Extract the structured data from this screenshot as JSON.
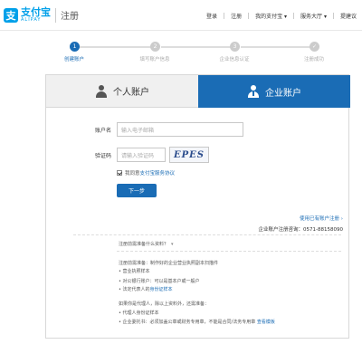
{
  "header": {
    "logo_glyph": "支",
    "logo_cn": "支付宝",
    "logo_en": "ALIPAY",
    "subtitle": "注册",
    "nav": [
      "登录",
      "注册",
      "我的支付宝",
      "服务大厅",
      "提建议"
    ]
  },
  "steps": [
    {
      "num": "1",
      "label": "创建账户",
      "active": true
    },
    {
      "num": "2",
      "label": "填写账户信息",
      "active": false
    },
    {
      "num": "3",
      "label": "企业信息认证",
      "active": false
    },
    {
      "num": "✓",
      "label": "注册成功",
      "active": false
    }
  ],
  "tabs": {
    "personal": "个人账户",
    "enterprise": "企业账户"
  },
  "form": {
    "account_label": "账户名",
    "account_placeholder": "输入电子邮箱",
    "captcha_label": "验证码",
    "captcha_placeholder": "请输入验证码",
    "captcha_text": "EPES",
    "agree_text": "我同意",
    "agree_link": "支付宝服务协议",
    "next_label": "下一步"
  },
  "side": {
    "have_account": "使用已有账户注册 ›",
    "hotline": "企业账户注册咨询：0571-88158090"
  },
  "notes": {
    "title": "注册前需准备什么资料？",
    "line1": "注册前需准备：制作好的企业营业执照副本扫描件",
    "link1": "• 营业执照样本",
    "line2": "• 对公银行账户：可以是基本户或一般户",
    "line3": "• 法定代表人的",
    "link3": "身份证样本",
    "line4": "如果你是代理人，除以上资料外，还需准备：",
    "link4": "• 代理人身份证样本",
    "line5": "• 企业委托书：必须加盖公章或财务专用章，不能是合同/法务专用章",
    "link5": "查看模板"
  },
  "colors": {
    "primary": "#1a6cb5",
    "logo": "#00a0e9"
  }
}
